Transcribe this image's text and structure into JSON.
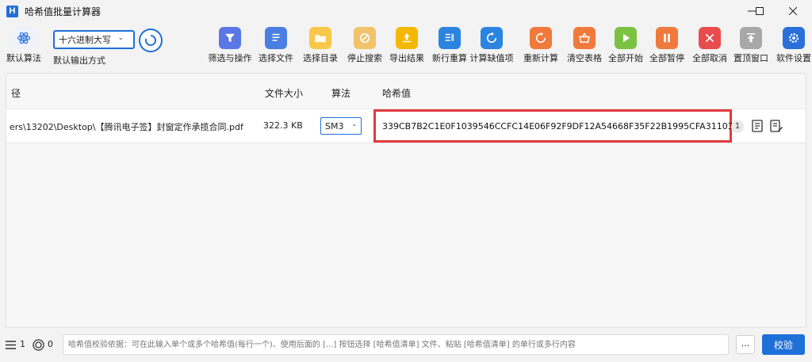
{
  "window": {
    "app_icon_letter": "H",
    "title": "哈希值批量计算器"
  },
  "toolbar": {
    "default_algo_label": "默认算法",
    "output_format": {
      "selected": "十六进制大写",
      "label": "默认输出方式"
    },
    "buttons": [
      {
        "label": "筛选与操作",
        "icon": "filter-icon",
        "color": "#5b77e6"
      },
      {
        "label": "选择文件",
        "icon": "file-list-icon",
        "color": "#4a7ee0"
      },
      {
        "label": "选择目录",
        "icon": "folder-icon",
        "color": "#f7c84a"
      },
      {
        "label": "停止搜索",
        "icon": "stop-circle-icon",
        "color": "#f2c36b"
      },
      {
        "label": "导出结果",
        "icon": "export-icon",
        "color": "#f5b800"
      },
      {
        "label": "新行重算",
        "icon": "new-row-icon",
        "color": "#2b84e0"
      },
      {
        "label": "计算缺值项",
        "icon": "recalc-missing-icon",
        "color": "#2b84e0"
      },
      {
        "label": "重新计算",
        "icon": "recalc-icon",
        "color": "#f07a3c"
      },
      {
        "label": "清空表格",
        "icon": "basket-icon",
        "color": "#f07a3c"
      },
      {
        "label": "全部开始",
        "icon": "play-icon",
        "color": "#7cc242"
      },
      {
        "label": "全部暂停",
        "icon": "pause-icon",
        "color": "#f07a3c"
      },
      {
        "label": "全部取消",
        "icon": "close-icon",
        "color": "#e84c4c"
      },
      {
        "label": "置顶窗口",
        "icon": "pin-top-icon",
        "color": "#a8a8a8"
      },
      {
        "label": "软件设置",
        "icon": "gear-icon",
        "color": "#2b6fd8"
      }
    ]
  },
  "table": {
    "headers": {
      "path": "径",
      "size": "文件大小",
      "algo": "算法",
      "hash": "哈希值"
    },
    "rows": [
      {
        "path": "ers\\13202\\Desktop\\【腾讯电子签】封窗定作承揽合同.pdf",
        "size": "322.3 KB",
        "algo": "SM3",
        "hash": "339CB7B2C1E0F1039546CCFC14E06F92F9DF12A54668F35F22B1995CFA311033",
        "count": "1"
      }
    ]
  },
  "bottom": {
    "list_count": "1",
    "target_count": "0",
    "verify_placeholder": "哈希值校验依据：可在此输入单个或多个哈希值(每行一个)、使用后面的 [...] 按钮选择 [哈希值清单] 文件、粘贴 [哈希值清单] 的单行或多行内容",
    "more_label": "...",
    "verify_label": "校验"
  }
}
